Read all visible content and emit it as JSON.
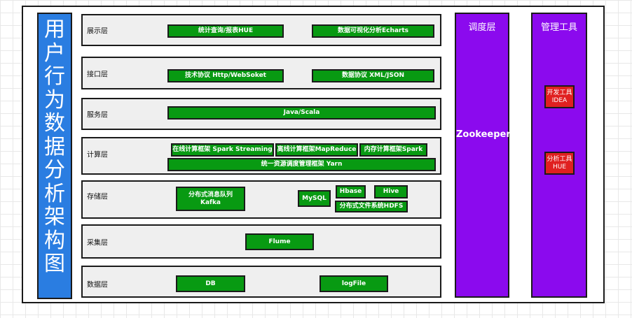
{
  "title": "用户行为数据分析架构图",
  "layers": {
    "display": {
      "label": "展示层",
      "items": [
        "统计查询/报表HUE",
        "数据可视化分析Echarts"
      ]
    },
    "api": {
      "label": "接口层",
      "items": [
        "技术协议 Http/WebSoket",
        "数据协议 XML/JSON"
      ]
    },
    "service": {
      "label": "服务层",
      "items": [
        "Java/Scala"
      ]
    },
    "compute": {
      "label": "计算层",
      "items": [
        "在线计算框架 Spark Streaming",
        "离线计算框架MapReduce",
        "内存计算框架Spark",
        "统一资源调度管理框架 Yarn"
      ]
    },
    "storage": {
      "label": "存储层",
      "items": [
        "分布式消息队列 Kafka",
        "MySQL",
        "Hbase",
        "Hive",
        "分布式文件系统HDFS"
      ]
    },
    "collect": {
      "label": "采集层",
      "items": [
        "Flume"
      ]
    },
    "data": {
      "label": "数据层",
      "items": [
        "DB",
        "logFile"
      ]
    }
  },
  "scheduler": {
    "title": "调度层",
    "content": "Zookeeper"
  },
  "tools": {
    "title": "管理工具",
    "items": [
      "开发工具 IDEA",
      "分析工具 HUE"
    ]
  },
  "colors": {
    "title_bar": "#2a7de1",
    "component": "#089a12",
    "column": "#8b0aee",
    "tool": "#e02020",
    "layer_bg": "#efefef"
  }
}
